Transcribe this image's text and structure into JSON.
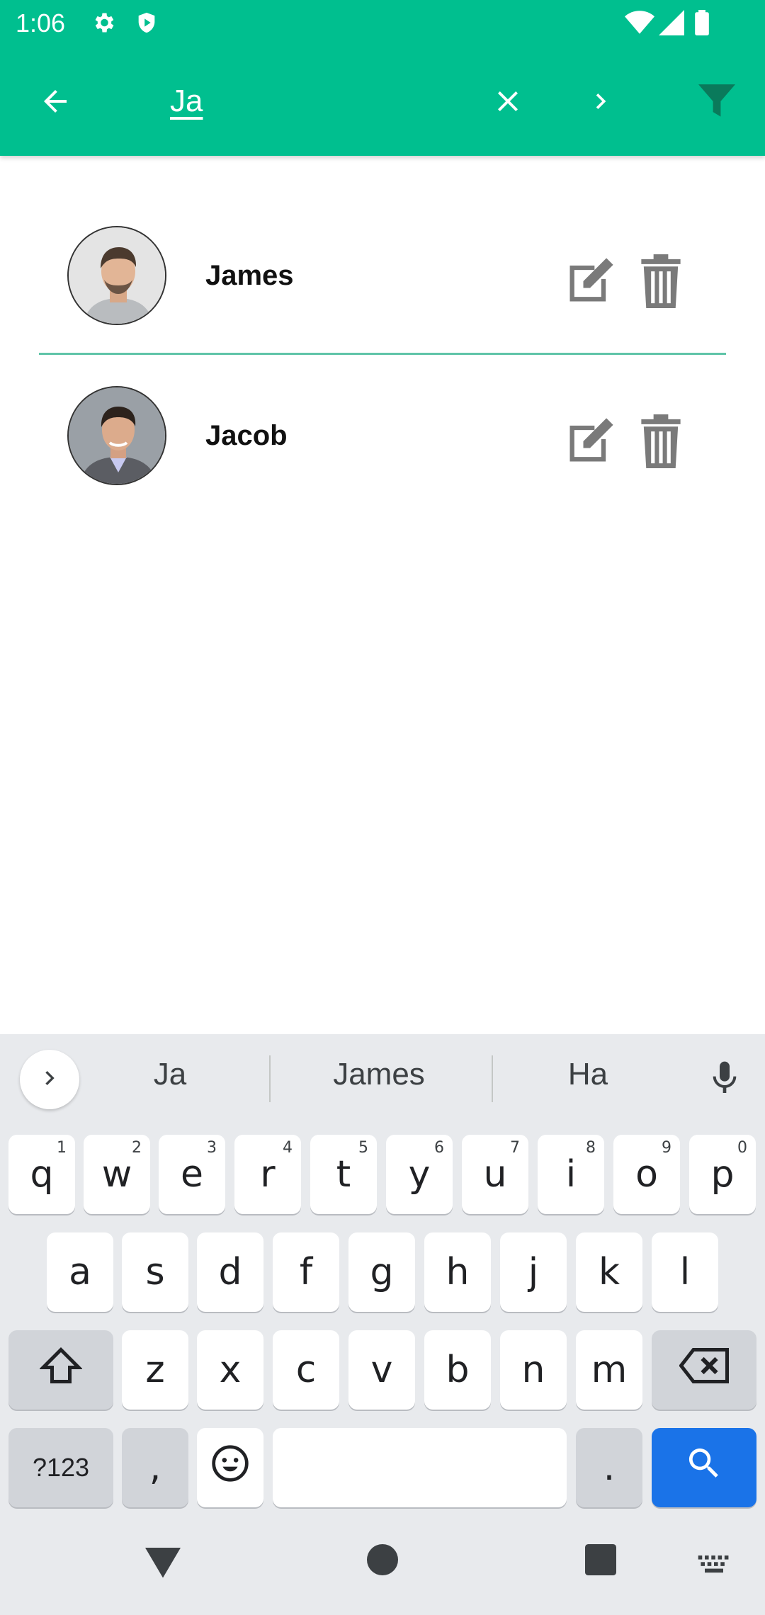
{
  "status_bar": {
    "time": "1:06",
    "icons": [
      "gear-icon",
      "shield-icon",
      "wifi-icon",
      "signal-icon",
      "battery-icon"
    ]
  },
  "app_bar": {
    "back_icon": "arrow-left-icon",
    "search_value": "Ja",
    "clear_icon": "close-icon",
    "next_icon": "chevron-right-icon",
    "filter_icon": "filter-icon",
    "background_color": "#00bf8f"
  },
  "results": [
    {
      "name": "James",
      "edit_icon": "edit-icon",
      "delete_icon": "trash-icon"
    },
    {
      "name": "Jacob",
      "edit_icon": "edit-icon",
      "delete_icon": "trash-icon"
    }
  ],
  "keyboard": {
    "suggestions": [
      "Ja",
      "James",
      "Ha"
    ],
    "row1": [
      {
        "key": "q",
        "sup": "1"
      },
      {
        "key": "w",
        "sup": "2"
      },
      {
        "key": "e",
        "sup": "3"
      },
      {
        "key": "r",
        "sup": "4"
      },
      {
        "key": "t",
        "sup": "5"
      },
      {
        "key": "y",
        "sup": "6"
      },
      {
        "key": "u",
        "sup": "7"
      },
      {
        "key": "i",
        "sup": "8"
      },
      {
        "key": "o",
        "sup": "9"
      },
      {
        "key": "p",
        "sup": "0"
      }
    ],
    "row2": [
      "a",
      "s",
      "d",
      "f",
      "g",
      "h",
      "j",
      "k",
      "l"
    ],
    "row3": [
      "z",
      "x",
      "c",
      "v",
      "b",
      "n",
      "m"
    ],
    "symbols_label": "?123",
    "comma_label": ",",
    "period_label": ".",
    "accent_color": "#1a73e8"
  },
  "nav_bar": {
    "icons": [
      "back-triangle-icon",
      "home-circle-icon",
      "recents-square-icon",
      "keyboard-switch-icon"
    ]
  }
}
